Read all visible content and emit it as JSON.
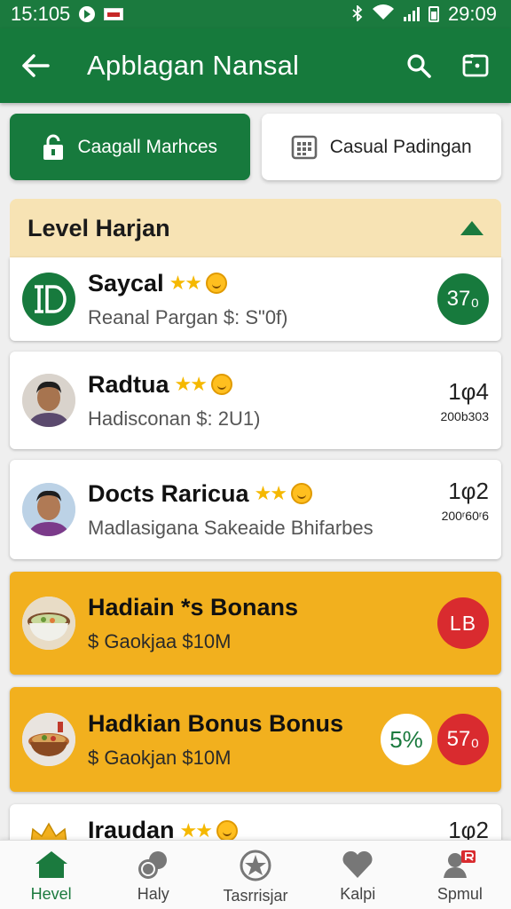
{
  "status": {
    "time": "15:105",
    "right_time": "29:09"
  },
  "appbar": {
    "title": "Apblagan Nansal"
  },
  "tabs": [
    {
      "label": "Caagall Marhces",
      "active": true
    },
    {
      "label": "Casual Padingan",
      "active": false
    }
  ],
  "section": {
    "title": "Level Harjan"
  },
  "items": [
    {
      "title": "Saycal",
      "stars": "★★",
      "subtitle": "Reanal Pargan $: S\"0f)",
      "badge": "37₀",
      "type": "normal"
    },
    {
      "title": "Radtua",
      "stars": "★★",
      "subtitle": "Hadisconan $: 2U1)",
      "right_big": "1φ4",
      "right_small": "200b303",
      "type": "normal"
    },
    {
      "title": "Docts Raricua",
      "stars": "★★",
      "subtitle": "Madlasigana Sakeaide Bhifarbes",
      "right_big": "1φ2",
      "right_small": "200ʳ60ʳ6",
      "type": "normal"
    },
    {
      "title": "Hadiain *s Bonans",
      "subtitle": "$ Gaokjaa $10M",
      "badge": "LB",
      "type": "bonus"
    },
    {
      "title": "Hadkian Bonus Bonus",
      "subtitle": "$ Gaokjan $10M",
      "badge_left": "5%",
      "badge": "57₀",
      "type": "bonus"
    },
    {
      "title": "Iraudan",
      "stars": "★★",
      "right_big": "1φ2",
      "type": "normal"
    }
  ],
  "nav": [
    {
      "label": "Hevel",
      "icon": "home-icon",
      "active": true
    },
    {
      "label": "Haly",
      "icon": "chat-icon",
      "active": false
    },
    {
      "label": "Tasrrisjar",
      "icon": "star-icon",
      "active": false
    },
    {
      "label": "Kalpi",
      "icon": "heart-icon",
      "active": false
    },
    {
      "label": "Spmul",
      "icon": "profile-icon",
      "active": false
    }
  ],
  "colors": {
    "primary": "#167a3c",
    "bonus": "#f2b01e",
    "red_badge": "#d92b2f",
    "header_bg": "#f7e3b4"
  }
}
